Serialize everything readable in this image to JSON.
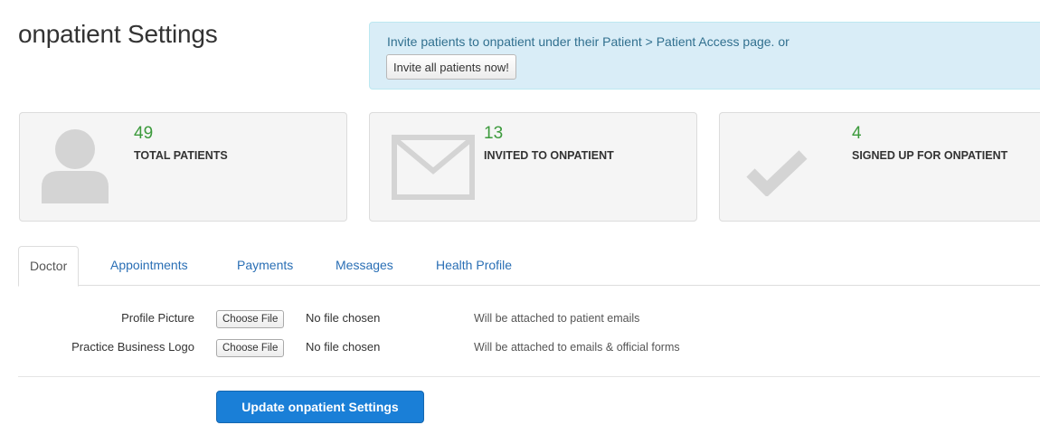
{
  "header": {
    "title": "onpatient Settings"
  },
  "invite_box": {
    "message": "Invite patients to onpatient under their Patient > Patient Access page. or",
    "button_label": "Invite all patients now!"
  },
  "stats": [
    {
      "value": "49",
      "label": "TOTAL PATIENTS",
      "icon": "person-icon"
    },
    {
      "value": "13",
      "label": "INVITED TO ONPATIENT",
      "icon": "envelope-icon"
    },
    {
      "value": "4",
      "label": "SIGNED UP FOR ONPATIENT",
      "icon": "checkmark-icon"
    }
  ],
  "tabs": [
    {
      "label": "Doctor",
      "active": true
    },
    {
      "label": "Appointments",
      "active": false
    },
    {
      "label": "Payments",
      "active": false
    },
    {
      "label": "Messages",
      "active": false
    },
    {
      "label": "Health Profile",
      "active": false
    }
  ],
  "form": {
    "fields": [
      {
        "label": "Profile Picture",
        "button_label": "Choose File",
        "status": "No file chosen",
        "help": "Will be attached to patient emails"
      },
      {
        "label": "Practice Business Logo",
        "button_label": "Choose File",
        "status": "No file chosen",
        "help": "Will be attached to emails & official forms"
      }
    ],
    "submit_label": "Update onpatient Settings"
  },
  "colors": {
    "info_background": "#d9edf7",
    "info_text": "#31708f",
    "stat_value": "#3c9a3c",
    "link": "#2a6fb5",
    "primary_button": "#1a7fd7",
    "icon_gray": "#d4d4d4"
  }
}
